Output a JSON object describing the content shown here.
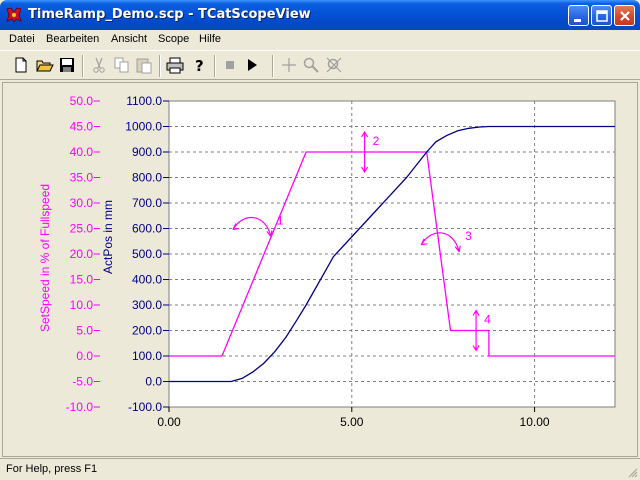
{
  "window": {
    "title": "TimeRamp_Demo.scp - TCatScopeView",
    "icon": "twincat-scope-icon"
  },
  "menu": [
    "Datei",
    "Bearbeiten",
    "Ansicht",
    "Scope",
    "Hilfe"
  ],
  "toolbar": {
    "icons": [
      "new-file-icon",
      "open-folder-icon",
      "save-icon",
      "cut-icon",
      "copy-icon",
      "paste-icon",
      "print-icon",
      "help-icon",
      "stop-icon",
      "play-icon",
      "crosshair-icon",
      "zoom-icon",
      "zoom-reset-icon"
    ]
  },
  "statusbar": {
    "text": "For Help, press F1"
  },
  "colors": {
    "setspeed": "#FF00FF",
    "actpos": "#000080",
    "plot_bg": "#FFFFFF",
    "grid": "#808080"
  },
  "chart_data": {
    "type": "line",
    "xlabel": "",
    "xlim": [
      0,
      12.2
    ],
    "x_ticks": [
      "0.00",
      "5.00",
      "10.00"
    ],
    "grid": true,
    "axes": [
      {
        "label": "SetSpeed in % of Fullspeed",
        "color": "#FF00FF",
        "ylim": [
          -10,
          50
        ],
        "ticks": [
          "50.0",
          "45.0",
          "40.0",
          "35.0",
          "30.0",
          "25.0",
          "20.0",
          "15.0",
          "10.0",
          "5.0",
          "0.0",
          "-5.0",
          "-10.0"
        ]
      },
      {
        "label": "ActPos in mm",
        "color": "#000080",
        "ylim": [
          -100,
          1100
        ],
        "ticks": [
          "1100.0",
          "1000.0",
          "900.0",
          "800.0",
          "700.0",
          "600.0",
          "500.0",
          "400.0",
          "300.0",
          "200.0",
          "100.0",
          "0.0",
          "-100.0"
        ]
      }
    ],
    "series": [
      {
        "axis": 0,
        "color": "#FF00FF",
        "x": [
          0,
          1.45,
          3.75,
          7.05,
          7.7,
          7.7,
          8.75,
          8.75,
          12.2
        ],
        "values": [
          0,
          0,
          40,
          40,
          5,
          5,
          5,
          0,
          0
        ]
      },
      {
        "axis": 1,
        "color": "#000080",
        "x": [
          0,
          1.7,
          2.0,
          2.3,
          2.6,
          2.9,
          3.2,
          3.5,
          3.75,
          4.5,
          5.5,
          6.5,
          7.05,
          7.3,
          7.6,
          7.9,
          8.2,
          8.5,
          8.75,
          12.2
        ],
        "values": [
          0,
          0,
          12,
          38,
          72,
          118,
          174,
          242,
          300,
          490,
          645,
          800,
          900,
          940,
          965,
          983,
          993,
          998,
          1000,
          1000
        ]
      }
    ],
    "annotations": [
      {
        "label": "1",
        "type": "curved-arrow",
        "x": 2.35,
        "value": 25
      },
      {
        "label": "2",
        "type": "double-arrow",
        "x": 5.35,
        "value": 40
      },
      {
        "label": "3",
        "type": "curved-arrow",
        "x": 7.5,
        "value": 22
      },
      {
        "label": "4",
        "type": "double-arrow",
        "x": 8.4,
        "value": 5
      }
    ]
  }
}
